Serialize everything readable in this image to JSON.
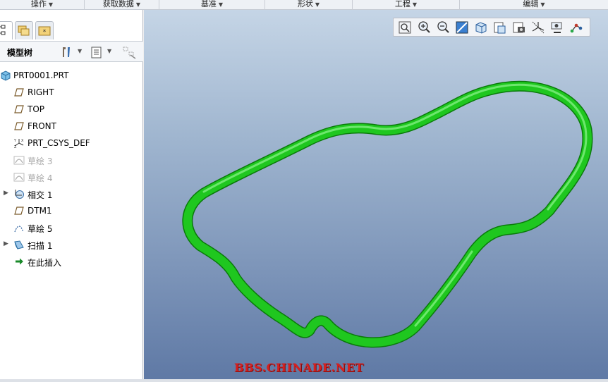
{
  "ribbon": {
    "groups": [
      {
        "label": "操作"
      },
      {
        "label": "获取数据"
      },
      {
        "label": "基准"
      },
      {
        "label": "形状"
      },
      {
        "label": "工程"
      },
      {
        "label": "编辑"
      }
    ]
  },
  "model_tree": {
    "title": "模型树",
    "items": [
      {
        "label": "PRT0001.PRT",
        "icon": "part-icon",
        "expandable": false,
        "dimmed": false
      },
      {
        "label": "RIGHT",
        "icon": "datum-plane-icon",
        "expandable": false,
        "dimmed": false
      },
      {
        "label": "TOP",
        "icon": "datum-plane-icon",
        "expandable": false,
        "dimmed": false
      },
      {
        "label": "FRONT",
        "icon": "datum-plane-icon",
        "expandable": false,
        "dimmed": false
      },
      {
        "label": "PRT_CSYS_DEF",
        "icon": "csys-icon",
        "expandable": false,
        "dimmed": false
      },
      {
        "label": "草绘 3",
        "icon": "sketch-icon",
        "expandable": false,
        "dimmed": true
      },
      {
        "label": "草绘 4",
        "icon": "sketch-icon",
        "expandable": false,
        "dimmed": true
      },
      {
        "label": "相交 1",
        "icon": "intersect-icon",
        "expandable": true,
        "dimmed": false
      },
      {
        "label": "DTM1",
        "icon": "datum-plane-icon",
        "expandable": false,
        "dimmed": false
      },
      {
        "label": "草绘 5",
        "icon": "sketch-curve-icon",
        "expandable": false,
        "dimmed": false
      },
      {
        "label": "扫描 1",
        "icon": "sweep-icon",
        "expandable": true,
        "dimmed": false
      },
      {
        "label": "在此插入",
        "icon": "insert-arrow-icon",
        "expandable": false,
        "dimmed": false
      }
    ]
  },
  "view_toolbar": {
    "buttons": [
      "refit-icon",
      "zoom-in-icon",
      "zoom-out-icon",
      "repaint-icon",
      "display-style-icon",
      "saved-views-icon",
      "view-manager-icon",
      "datum-display-icon",
      "spin-center-icon",
      "annotation-icon"
    ]
  },
  "colors": {
    "sweep": "#1fc71f",
    "watermark": "#d62020"
  },
  "watermark": "BBS.CHINADE.NET"
}
